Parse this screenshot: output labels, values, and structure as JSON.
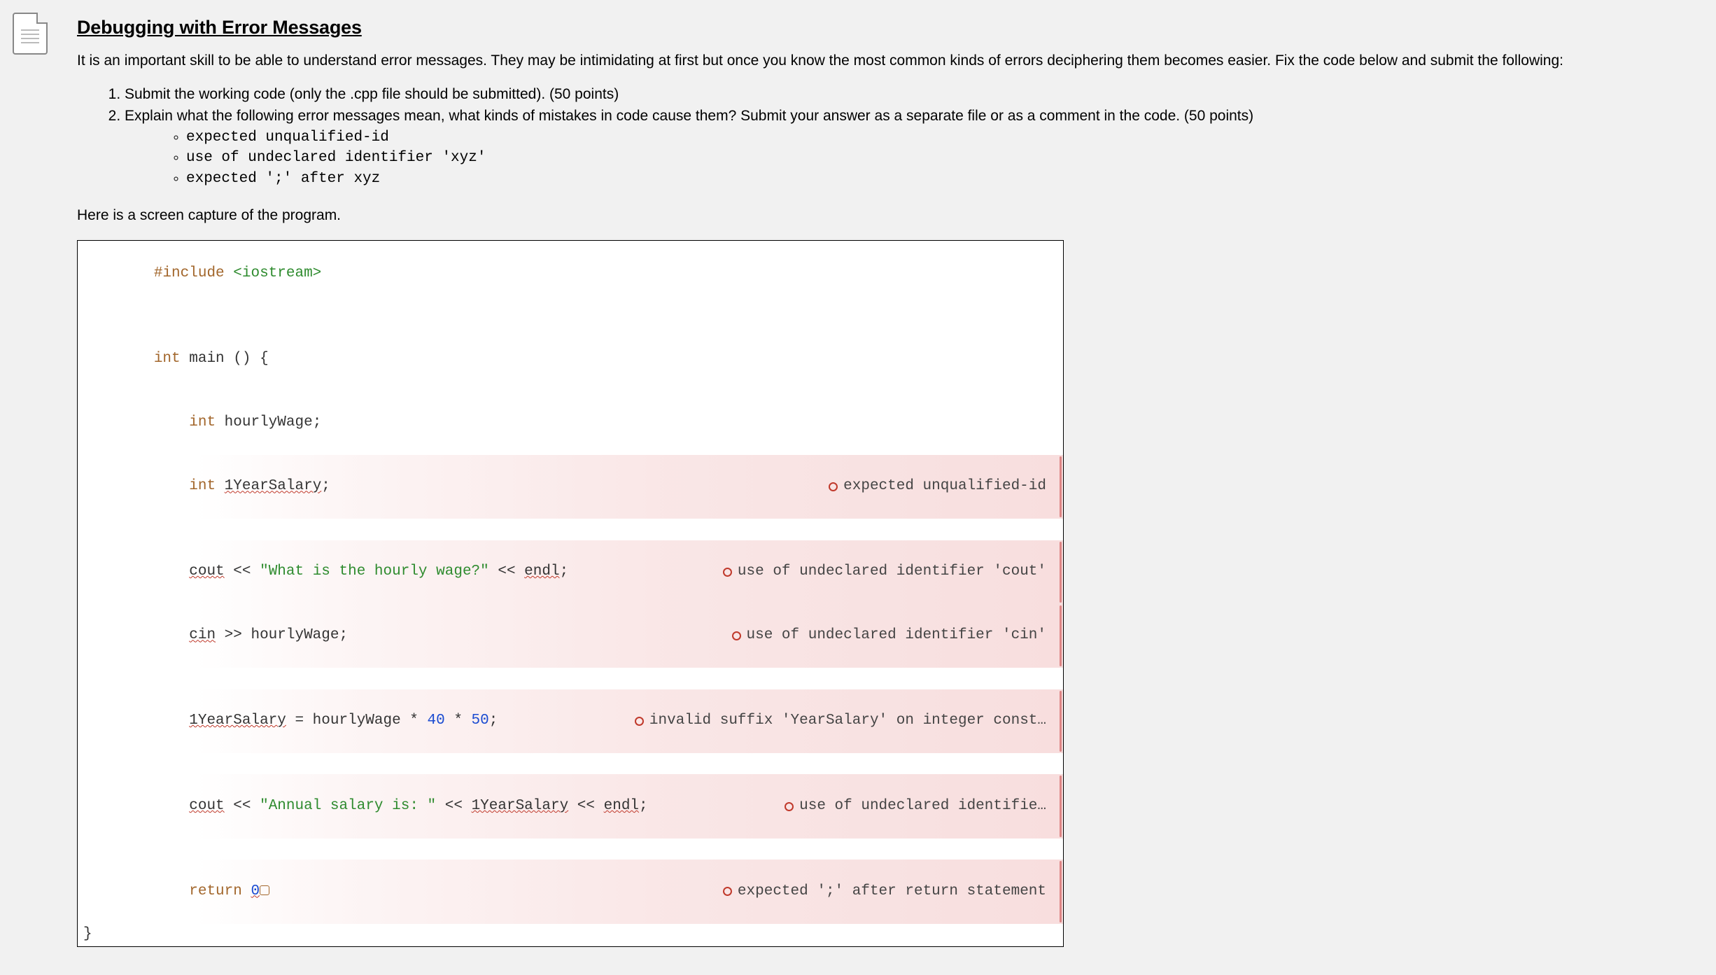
{
  "heading": "Debugging with Error Messages",
  "intro": "It is an important skill to be able to understand error messages. They may be intimidating at first but once you know the most common kinds of errors deciphering them becomes easier. Fix the code below and submit the following:",
  "list": {
    "item1": "Submit the working code (only the .cpp file should be submitted). (50 points)",
    "item2": "Explain what the following error messages mean, what kinds of mistakes in code cause them? Submit your answer as a separate file or as a comment in the code. (50 points)",
    "sub1": "expected unqualified-id",
    "sub2": "use of undeclared identifier 'xyz'",
    "sub3": "expected ';' after xyz"
  },
  "caption": "Here is a screen capture of the program.",
  "code": {
    "l1": {
      "pre": "#include",
      "sp": " ",
      "inc": "<iostream>"
    },
    "l3": {
      "kw": "int",
      "sp": " ",
      "fn": "main",
      "rest": " () {"
    },
    "l4": {
      "indent": "    ",
      "kw": "int",
      "sp": " ",
      "name": "hourlyWage",
      "semi": ";"
    },
    "l5": {
      "indent": "    ",
      "kw": "int",
      "sp": " ",
      "name": "1YearSalary",
      "semi": ";"
    },
    "l7": {
      "indent": "    ",
      "cout": "cout",
      "op1": " << ",
      "str": "\"What is the hourly wage?\"",
      "op2": " << ",
      "endl": "endl",
      "semi": ";"
    },
    "l8": {
      "indent": "    ",
      "cin": "cin",
      "op1": " >> hourlyWage;",
      "rest": ""
    },
    "l10": {
      "indent": "    ",
      "lhs": "1YearSalary",
      "op": " = hourlyWage * ",
      "n1": "40",
      "mul": " * ",
      "n2": "50",
      "semi": ";"
    },
    "l12": {
      "indent": "    ",
      "cout": "cout",
      "op1": " << ",
      "str": "\"Annual salary is: \"",
      "op2": " << ",
      "var": "1YearSalary",
      "op3": " << ",
      "endl": "endl",
      "semi": ";"
    },
    "l14": {
      "indent": "    ",
      "kw": "return",
      "sp": " ",
      "num": "0"
    },
    "l15": {
      "brace": "}"
    }
  },
  "errors": {
    "e5": "expected unqualified-id",
    "e7": "use of undeclared identifier 'cout'",
    "e8": "use of undeclared identifier 'cin'",
    "e10": "invalid suffix 'YearSalary' on integer const…",
    "e12": "use of undeclared identifie…",
    "e14": "expected ';' after return statement"
  }
}
